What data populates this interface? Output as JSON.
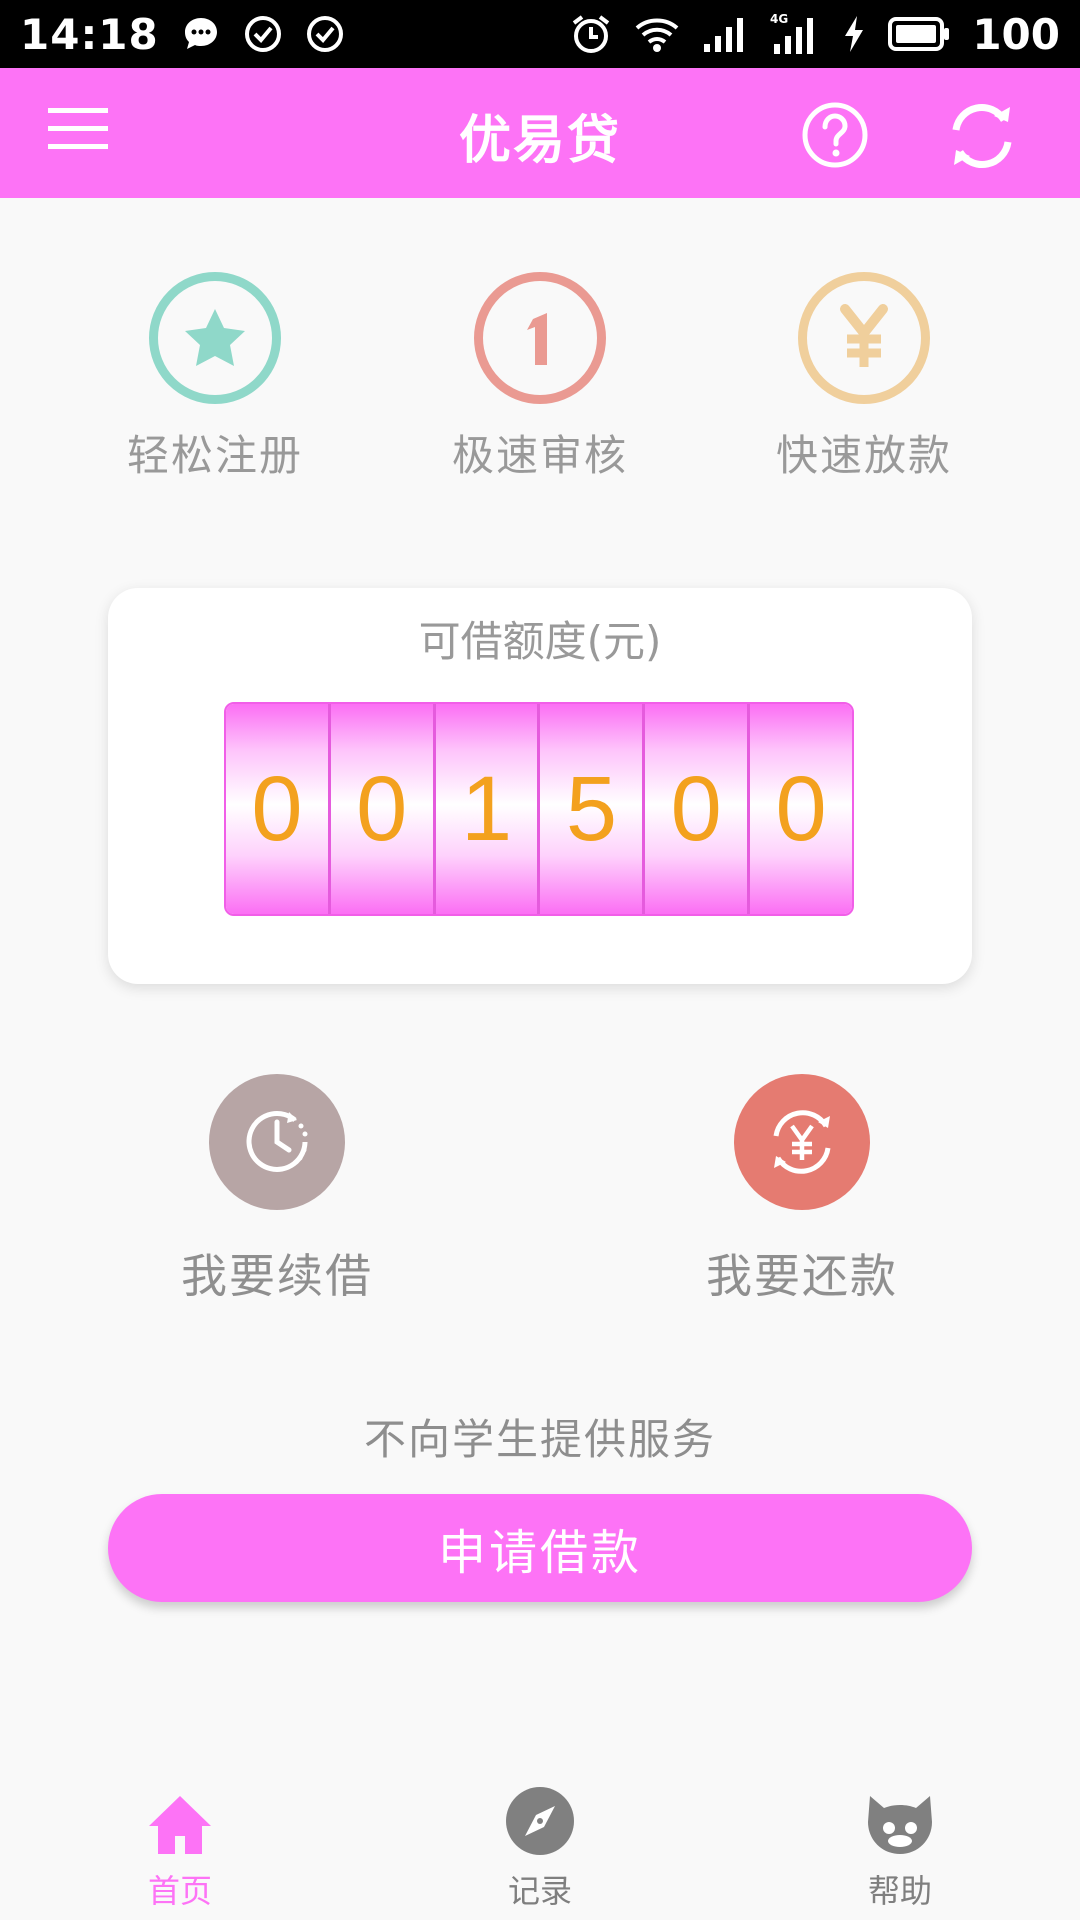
{
  "status_bar": {
    "time": "14:18",
    "battery": "100",
    "network": "4G"
  },
  "header": {
    "title": "优易贷"
  },
  "features": [
    {
      "label": "轻松注册",
      "icon": "star-icon",
      "color": "#8fd8c9"
    },
    {
      "label": "极速审核",
      "icon": "one-icon",
      "color": "#ea9a92"
    },
    {
      "label": "快速放款",
      "icon": "yuan-icon",
      "color": "#f0cf9c"
    }
  ],
  "credit": {
    "title": "可借额度(元)",
    "digits": [
      "0",
      "0",
      "1",
      "5",
      "0",
      "0"
    ]
  },
  "actions": [
    {
      "label": "我要续借",
      "icon": "clock-icon",
      "color": "#b7a5a5"
    },
    {
      "label": "我要还款",
      "icon": "yuan-exchange-icon",
      "color": "#e57b71"
    }
  ],
  "notice": "不向学生提供服务",
  "apply_button": "申请借款",
  "colors": {
    "brand": "#fd73f6",
    "digit_text": "#f3a11e"
  },
  "bottom_nav": [
    {
      "label": "首页",
      "icon": "home-icon",
      "active": true
    },
    {
      "label": "记录",
      "icon": "compass-icon",
      "active": false
    },
    {
      "label": "帮助",
      "icon": "cat-icon",
      "active": false
    }
  ]
}
